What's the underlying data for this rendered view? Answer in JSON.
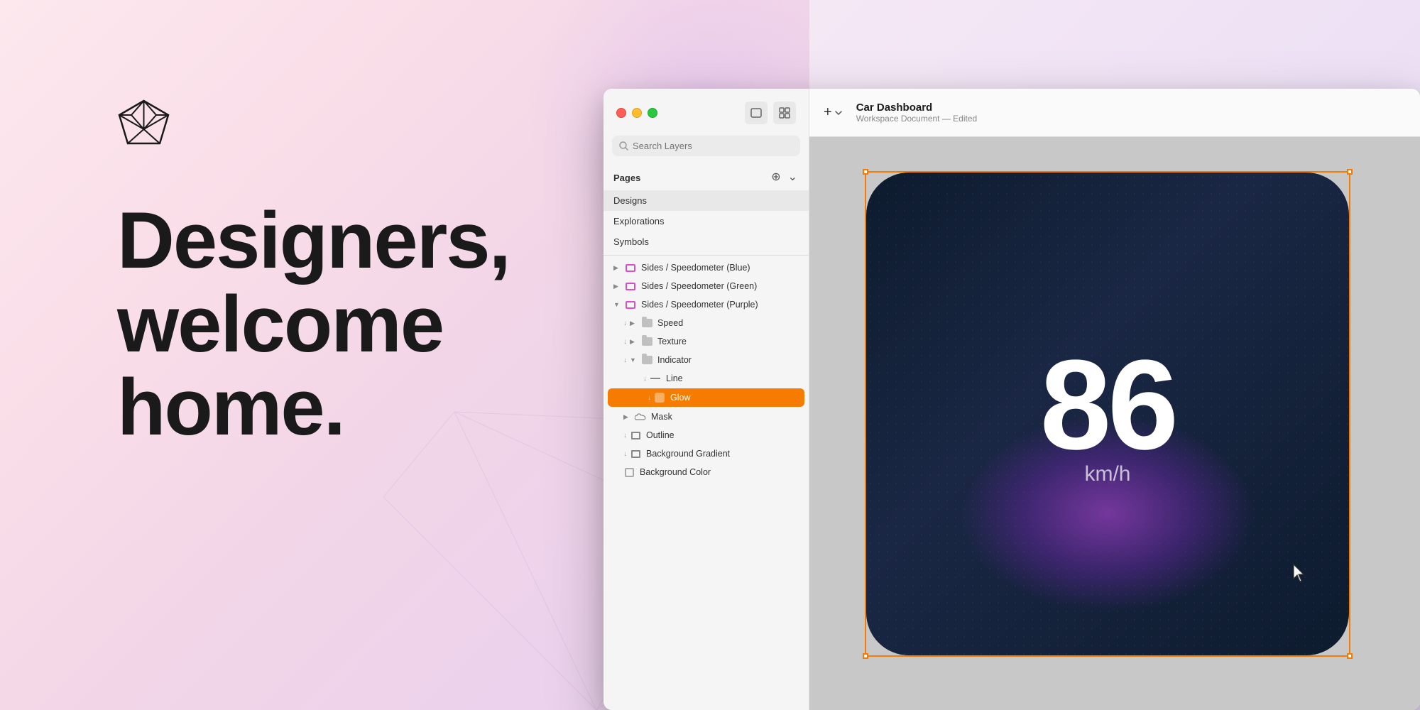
{
  "background": {
    "hero_text_line1": "Designers,",
    "hero_text_line2": "welcome",
    "hero_text_line3": "home."
  },
  "window": {
    "traffic_lights": {
      "red_label": "close",
      "yellow_label": "minimize",
      "green_label": "maximize"
    },
    "toolbar_icons": [
      "window-icon",
      "grid-icon"
    ],
    "search": {
      "placeholder": "Search Layers"
    },
    "pages": {
      "label": "Pages",
      "items": [
        {
          "name": "Designs",
          "active": true
        },
        {
          "name": "Explorations",
          "active": false
        },
        {
          "name": "Symbols",
          "active": false
        }
      ]
    },
    "layers": [
      {
        "indent": 0,
        "chevron": "▶",
        "icon": "symbol",
        "name": "Sides / Speedometer (Blue)",
        "expanded": false
      },
      {
        "indent": 0,
        "chevron": "▶",
        "icon": "symbol",
        "name": "Sides / Speedometer (Green)",
        "expanded": false
      },
      {
        "indent": 0,
        "chevron": "▼",
        "icon": "symbol",
        "name": "Sides / Speedometer (Purple)",
        "expanded": true
      },
      {
        "indent": 1,
        "chevron": "▶",
        "icon": "folder",
        "name": "Speed",
        "small_arrow": true
      },
      {
        "indent": 1,
        "chevron": "▶",
        "icon": "folder",
        "name": "Texture",
        "small_arrow": true
      },
      {
        "indent": 1,
        "chevron": "▼",
        "icon": "folder",
        "name": "Indicator",
        "small_arrow": true
      },
      {
        "indent": 2,
        "chevron": "",
        "icon": "line",
        "name": "Line",
        "small_arrow": true
      },
      {
        "indent": 2,
        "chevron": "",
        "icon": "orange-rect",
        "name": "Glow",
        "selected": true,
        "small_arrow": true
      },
      {
        "indent": 1,
        "chevron": "▶",
        "icon": "cloud",
        "name": "Mask"
      },
      {
        "indent": 1,
        "chevron": "",
        "icon": "rect-outline",
        "name": "Outline",
        "small_arrow": true
      },
      {
        "indent": 1,
        "chevron": "",
        "icon": "rect-outline",
        "name": "Background Gradient",
        "small_arrow": true
      },
      {
        "indent": 1,
        "chevron": "",
        "icon": "checkbox",
        "name": "Background Color"
      }
    ],
    "doc": {
      "title": "Car Dashboard",
      "subtitle": "Workspace Document — Edited"
    },
    "canvas": {
      "speed_number": "86",
      "speed_unit": "km/h"
    }
  }
}
